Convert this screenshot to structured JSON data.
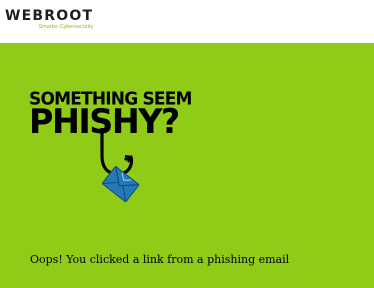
{
  "brand": {
    "name": "WEBROOT",
    "tagline": "Smarter Cybersecurity",
    "accent_color": "#8fcb17"
  },
  "hero": {
    "headline_line1": "SOMETHING SEEM",
    "headline_line2": "PHISHY?",
    "icon": "fish-hook-envelope-icon",
    "hook_color": "#000000",
    "envelope_color": "#2479b6"
  },
  "message": "Oops! You clicked a link from a phishing email"
}
